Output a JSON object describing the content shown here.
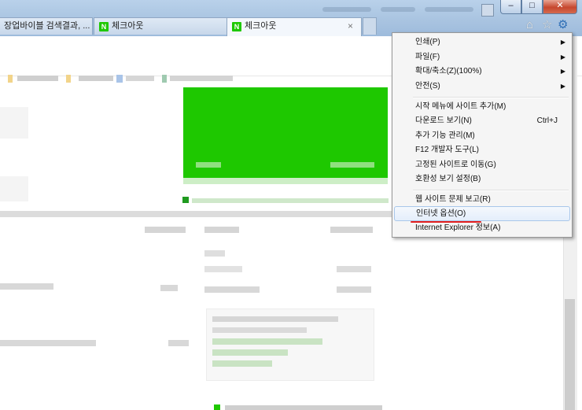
{
  "tabs": [
    {
      "label": "장업바이블 검색결과, ...",
      "active": false
    },
    {
      "label": "체크아웃",
      "active": false,
      "icon": "naver-n-icon"
    },
    {
      "label": "체크아웃",
      "active": true,
      "icon": "naver-n-icon"
    }
  ],
  "tab_icon_letter": "N",
  "tab_close_glyph": "×",
  "window_buttons": {
    "minimize": "–",
    "maximize": "□",
    "close": "✕"
  },
  "toolbar_icons": {
    "home": "⌂",
    "favorites": "☆",
    "tools": "⚙"
  },
  "tools_menu": {
    "items": [
      {
        "label": "인쇄(P)",
        "submenu": true
      },
      {
        "label": "파일(F)",
        "submenu": true
      },
      {
        "label": "확대/축소(Z)(100%)",
        "submenu": true
      },
      {
        "label": "안전(S)",
        "submenu": true
      },
      {
        "label": "시작 메뉴에 사이트 추가(M)"
      },
      {
        "label": "다운로드 보기(N)",
        "shortcut": "Ctrl+J"
      },
      {
        "label": "추가 기능 관리(M)"
      },
      {
        "label": "F12 개발자 도구(L)"
      },
      {
        "label": "고정된 사이트로 이동(G)"
      },
      {
        "label": "호환성 보기 설정(B)"
      },
      {
        "label": "웹 사이트 문제 보고(R)"
      },
      {
        "label": "인터넷 옵션(O)",
        "highlighted": true
      },
      {
        "label": "Internet Explorer 정보(A)"
      }
    ],
    "submenu_arrow": "▶"
  },
  "colors": {
    "brand_green": "#1ec800",
    "menu_highlight": "#e4eefb",
    "annotation_red": "#e31f1f"
  }
}
